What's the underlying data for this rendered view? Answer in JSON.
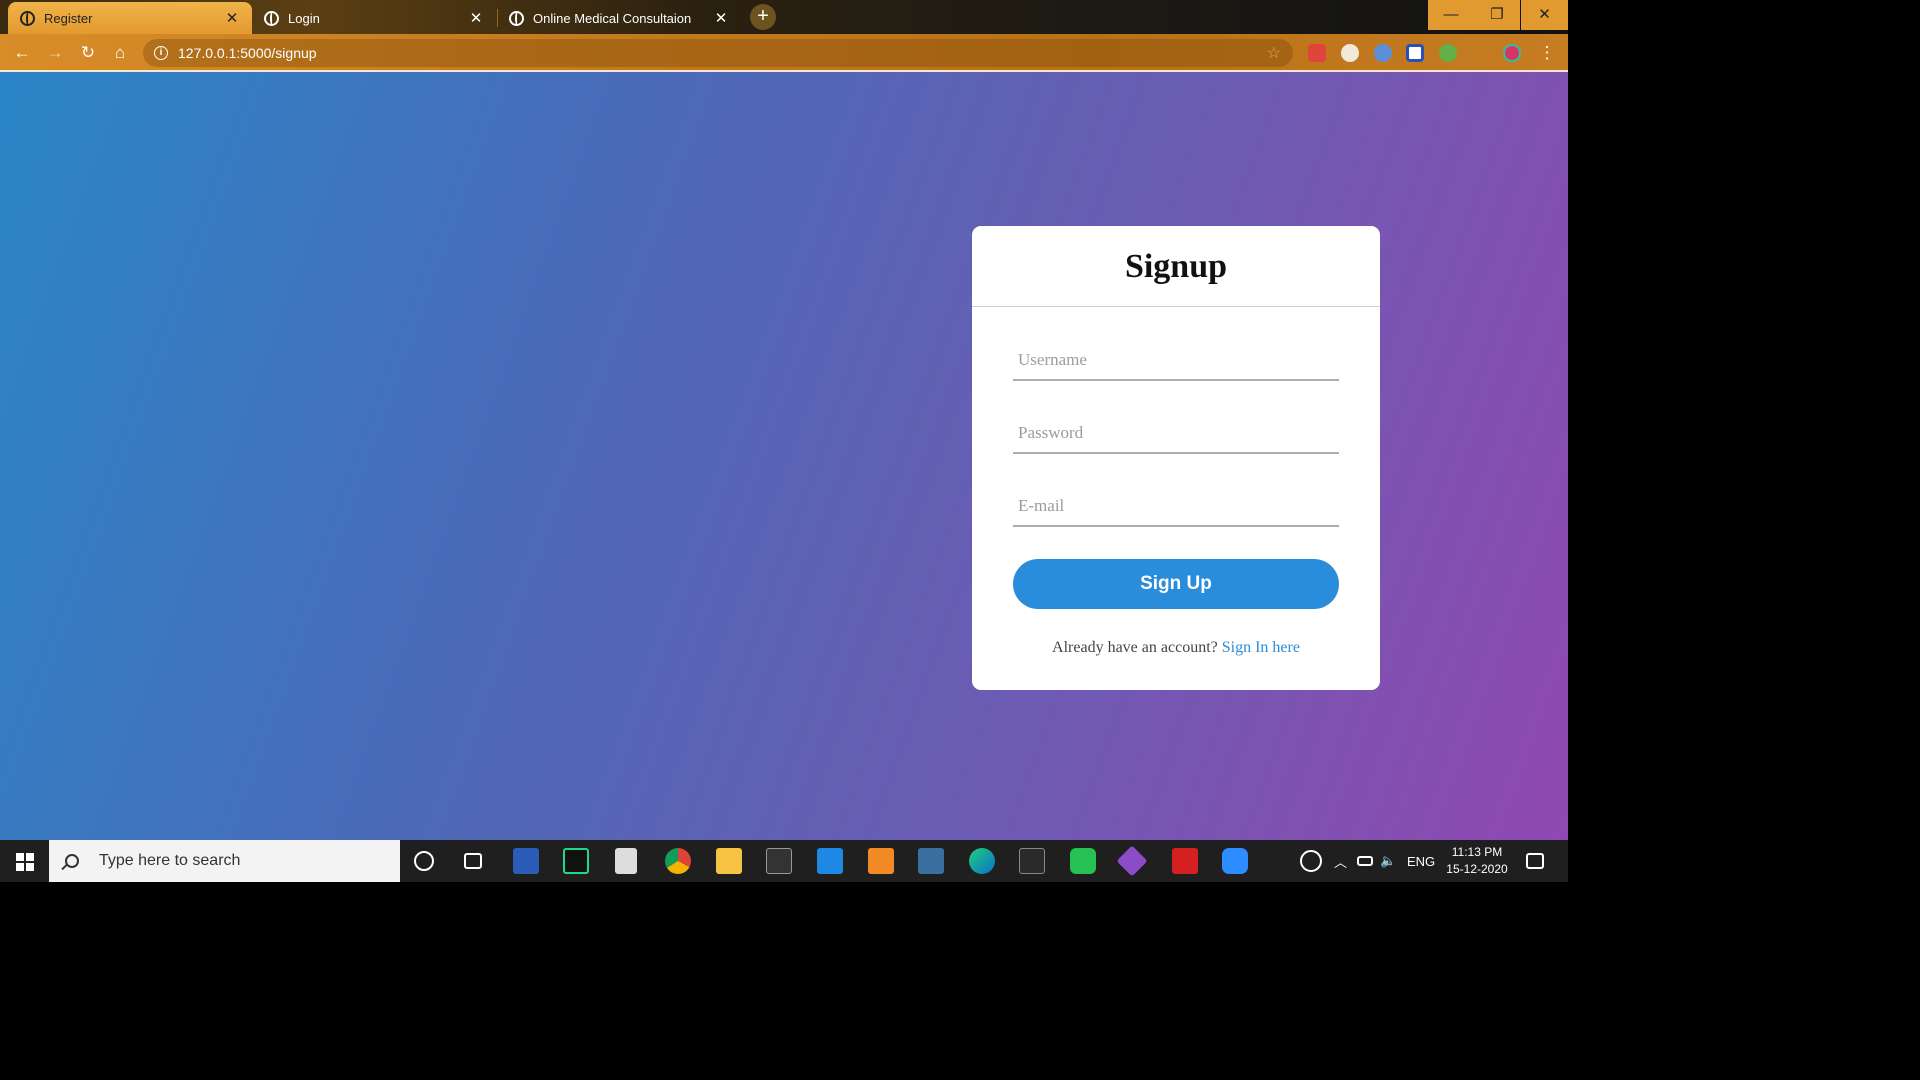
{
  "browser": {
    "tabs": [
      {
        "title": "Register",
        "active": true
      },
      {
        "title": "Login",
        "active": false
      },
      {
        "title": "Online Medical Consultaion",
        "active": false
      }
    ],
    "new_tab_label": "+",
    "close_glyph": "✕",
    "url": "127.0.0.1:5000/signup",
    "nav": {
      "back": "←",
      "forward": "→",
      "reload": "↻",
      "home": "⌂"
    },
    "window_controls": {
      "minimize": "—",
      "maximize": "❐",
      "close": "✕"
    },
    "info_glyph": "i",
    "star_glyph": "☆",
    "menu_glyph": "⋮"
  },
  "signup": {
    "title": "Signup",
    "username_placeholder": "Username",
    "password_placeholder": "Password",
    "email_placeholder": "E-mail",
    "button_label": "Sign Up",
    "footer_text": "Already have an account?",
    "signin_link": "Sign In here"
  },
  "taskbar": {
    "search_placeholder": "Type here to search",
    "language": "ENG",
    "time": "11:13 PM",
    "date": "15-12-2020"
  },
  "colors": {
    "accent": "#2a8ddb",
    "gradient_start": "#2a86c8",
    "gradient_end": "#9049b2"
  }
}
